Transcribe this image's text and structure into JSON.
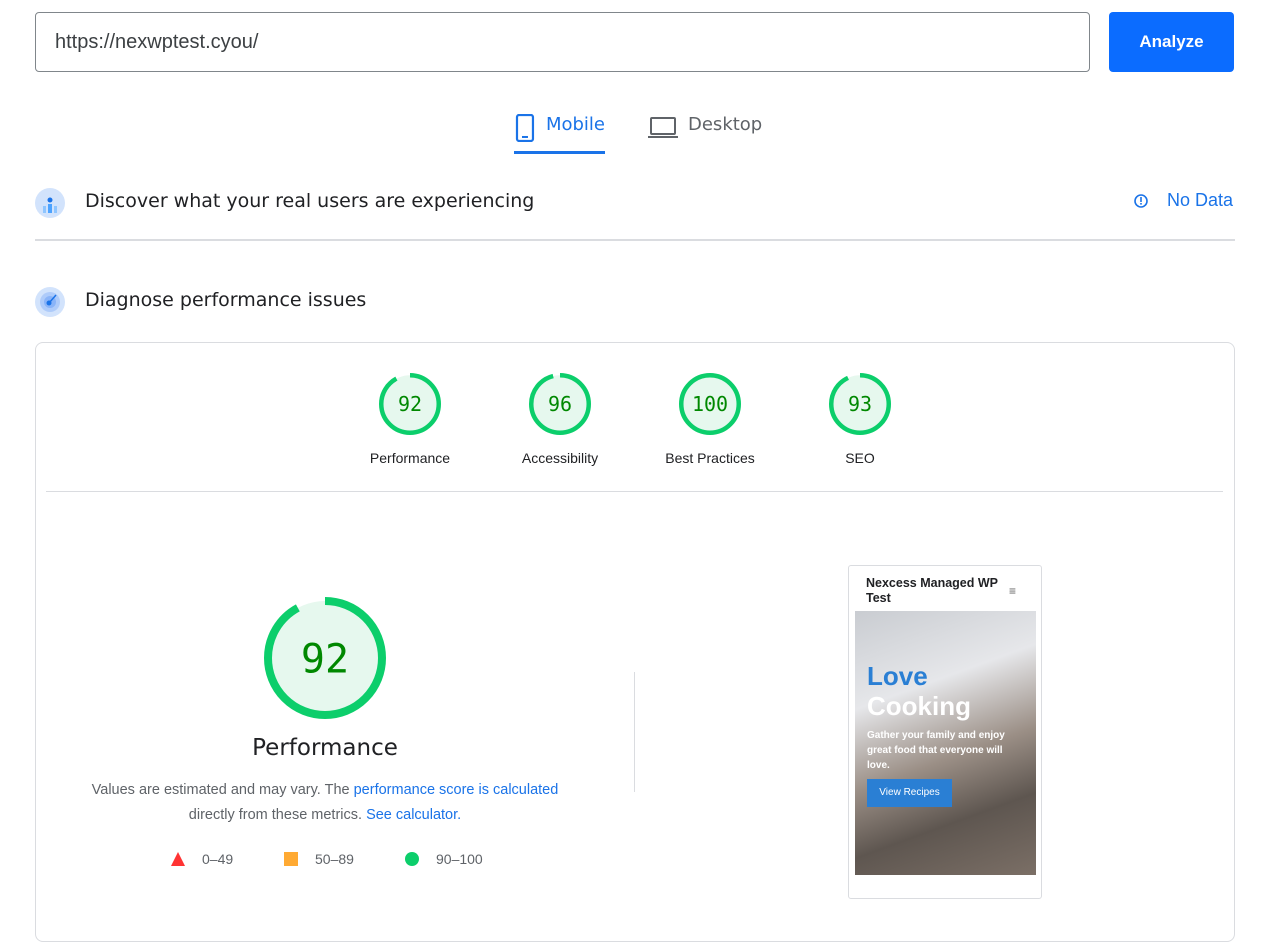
{
  "search": {
    "url": "https://nexwptest.cyou/",
    "analyze_label": "Analyze"
  },
  "tabs": [
    {
      "label": "Mobile",
      "icon": "phone-icon",
      "active": true
    },
    {
      "label": "Desktop",
      "icon": "laptop-icon",
      "active": false
    }
  ],
  "field_data": {
    "title": "Discover what your real users are experiencing",
    "status": "No Data",
    "icon": "info-icon"
  },
  "lab": {
    "title": "Diagnose performance issues"
  },
  "scores": [
    {
      "label": "Performance",
      "value": 92
    },
    {
      "label": "Accessibility",
      "value": 96
    },
    {
      "label": "Best Practices",
      "value": 100
    },
    {
      "label": "SEO",
      "value": 93
    }
  ],
  "main_score": {
    "value": 92,
    "title": "Performance",
    "desc_1": "Values are estimated and may vary. The ",
    "link_1": "performance score is calculated",
    "desc_2": "directly from these metrics. ",
    "link_2": "See calculator."
  },
  "legend": [
    {
      "range": "0–49",
      "color": "#ff3333"
    },
    {
      "range": "50–89",
      "color": "#ffaa33"
    },
    {
      "range": "90–100",
      "color": "#0cce6b"
    }
  ],
  "screenshot": {
    "site_title": "Nexcess Managed WP Test",
    "hero_1": "Love",
    "hero_2": "Cooking",
    "hero_text": "Gather your family and enjoy great food that everyone will love.",
    "button": "View Recipes"
  },
  "colors": {
    "accent": "#1a73e8",
    "pass": "#0cce6b",
    "pass_text": "#008800"
  }
}
